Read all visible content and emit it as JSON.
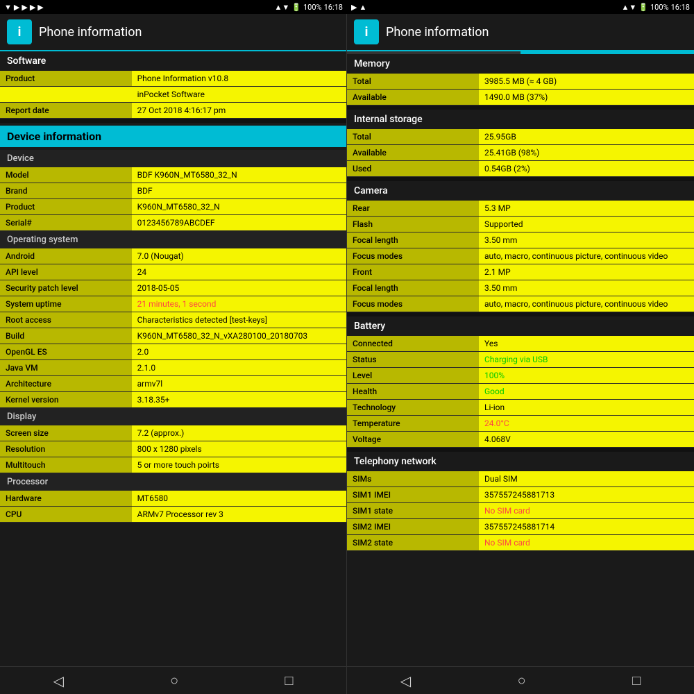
{
  "statusBar": {
    "left": {
      "icons": [
        "▼",
        "▶",
        "▶",
        "▶",
        "▶"
      ]
    },
    "right": {
      "signal": "▲▼",
      "battery": "100%",
      "time": "16:18"
    }
  },
  "panelLeft": {
    "header": {
      "iconText": "i",
      "title": "Phone information"
    },
    "tabs": [
      {
        "active": true
      },
      {
        "active": false
      }
    ],
    "software": {
      "sectionLabel": "Software",
      "rows": [
        {
          "label": "Product",
          "value": "Phone Information v10.8"
        },
        {
          "label": "",
          "value": "inPocket Software"
        },
        {
          "label": "Report date",
          "value": "27 Oct 2018 4:16:17 pm"
        }
      ]
    },
    "deviceInfo": {
      "sectionLabel": "Device information",
      "device": {
        "subLabel": "Device",
        "rows": [
          {
            "label": "Model",
            "value": "BDF K960N_MT6580_32_N"
          },
          {
            "label": "Brand",
            "value": "BDF"
          },
          {
            "label": "Product",
            "value": "K960N_MT6580_32_N"
          },
          {
            "label": "Serial#",
            "value": "0123456789ABCDEF"
          }
        ]
      },
      "os": {
        "subLabel": "Operating system",
        "rows": [
          {
            "label": "Android",
            "value": "7.0 (Nougat)",
            "valueClass": ""
          },
          {
            "label": "API level",
            "value": "24",
            "valueClass": ""
          },
          {
            "label": "Security patch level",
            "value": "2018-05-05",
            "valueClass": ""
          },
          {
            "label": "System uptime",
            "value": "21 minutes, 1 second",
            "valueClass": "text-red"
          },
          {
            "label": "Root access",
            "value": "Characteristics detected [test-keys]",
            "valueClass": ""
          },
          {
            "label": "Build",
            "value": "K960N_MT6580_32_N_vXA280100_20180703",
            "valueClass": ""
          },
          {
            "label": "OpenGL ES",
            "value": "2.0",
            "valueClass": ""
          },
          {
            "label": "Java VM",
            "value": "2.1.0",
            "valueClass": ""
          },
          {
            "label": "Architecture",
            "value": "armv7l",
            "valueClass": ""
          },
          {
            "label": "Kernel version",
            "value": "3.18.35+",
            "valueClass": ""
          }
        ]
      },
      "display": {
        "subLabel": "Display",
        "rows": [
          {
            "label": "Screen size",
            "value": "7.2 (approx.)",
            "valueClass": ""
          },
          {
            "label": "Resolution",
            "value": "800 x 1280 pixels",
            "valueClass": ""
          },
          {
            "label": "Multitouch",
            "value": "5 or more touch poirts",
            "valueClass": ""
          }
        ]
      },
      "processor": {
        "subLabel": "Processor",
        "rows": [
          {
            "label": "Hardware",
            "value": "MT6580",
            "valueClass": ""
          },
          {
            "label": "CPU",
            "value": "ARMv7 Processor rev 3",
            "valueClass": ""
          }
        ]
      }
    }
  },
  "panelRight": {
    "header": {
      "iconText": "i",
      "title": "Phone information"
    },
    "tabs": [
      {
        "active": false
      },
      {
        "active": true
      }
    ],
    "memory": {
      "sectionLabel": "Memory",
      "rows": [
        {
          "label": "Total",
          "value": "3985.5 MB (≈ 4 GB)"
        },
        {
          "label": "Available",
          "value": "1490.0 MB (37%)"
        }
      ]
    },
    "storage": {
      "sectionLabel": "Internal storage",
      "rows": [
        {
          "label": "Total",
          "value": "25.95GB"
        },
        {
          "label": "Available",
          "value": "25.41GB (98%)"
        },
        {
          "label": "Used",
          "value": "0.54GB (2%)"
        }
      ]
    },
    "camera": {
      "sectionLabel": "Camera",
      "rear": {
        "rows": [
          {
            "label": "Rear",
            "value": "5.3 MP"
          },
          {
            "label": "Flash",
            "value": "Supported"
          },
          {
            "label": "Focal length",
            "value": "3.50 mm"
          },
          {
            "label": "Focus modes",
            "value": "auto, macro, continuous picture, continuous video"
          }
        ]
      },
      "front": {
        "rows": [
          {
            "label": "Front",
            "value": "2.1 MP"
          },
          {
            "label": "Focal length",
            "value": "3.50 mm"
          },
          {
            "label": "Focus modes",
            "value": "auto, macro, continuous picture, continuous video"
          }
        ]
      }
    },
    "battery": {
      "sectionLabel": "Battery",
      "rows": [
        {
          "label": "Connected",
          "value": "Yes",
          "valueClass": ""
        },
        {
          "label": "Status",
          "value": "Charging via USB",
          "valueClass": "text-green"
        },
        {
          "label": "Level",
          "value": "100%",
          "valueClass": "text-green"
        },
        {
          "label": "Health",
          "value": "Good",
          "valueClass": "text-green"
        },
        {
          "label": "Technology",
          "value": "Li-ion",
          "valueClass": ""
        },
        {
          "label": "Temperature",
          "value": "24.0°C",
          "valueClass": "text-red"
        },
        {
          "label": "Voltage",
          "value": "4.068V",
          "valueClass": ""
        }
      ]
    },
    "telephony": {
      "sectionLabel": "Telephony network",
      "rows": [
        {
          "label": "SIMs",
          "value": "Dual SIM",
          "valueClass": ""
        },
        {
          "label": "SIM1 IMEI",
          "value": "357557245881713",
          "valueClass": ""
        },
        {
          "label": "SIM1 state",
          "value": "No SIM card",
          "valueClass": "text-red"
        },
        {
          "label": "SIM2 IMEI",
          "value": "357557245881714",
          "valueClass": ""
        },
        {
          "label": "SIM2 state",
          "value": "No SIM card",
          "valueClass": "text-red"
        }
      ]
    }
  },
  "nav": {
    "back": "◁",
    "home": "○",
    "recent": "□"
  }
}
